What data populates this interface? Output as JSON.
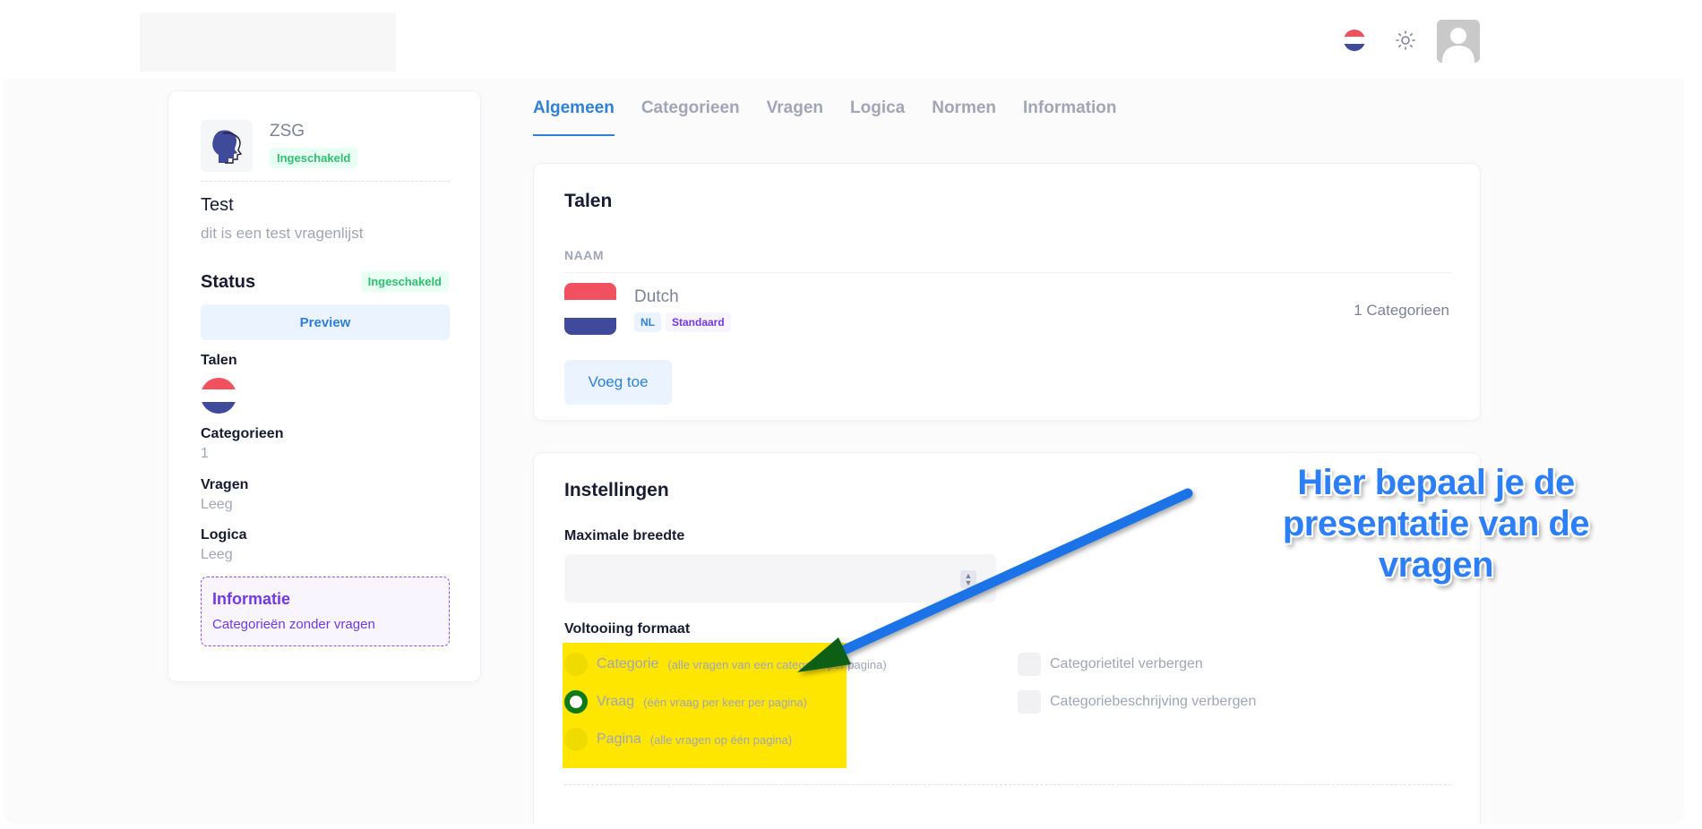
{
  "header": {
    "language_flag": "flag-nl-icon",
    "theme_icon": "sun-icon",
    "avatar_icon": "user-avatar-icon"
  },
  "sidebar": {
    "org_name": "ZSG",
    "org_status": "Ingeschakeld",
    "title": "Test",
    "description": "dit is een test vragenlijst",
    "status_label": "Status",
    "status_badge": "Ingeschakeld",
    "preview_button": "Preview",
    "talen_label": "Talen",
    "categorieen_label": "Categorieen",
    "categorieen_value": "1",
    "vragen_label": "Vragen",
    "vragen_value": "Leeg",
    "logica_label": "Logica",
    "logica_value": "Leeg",
    "info_title": "Informatie",
    "info_text": "Categorieën zonder vragen"
  },
  "tabs": [
    "Algemeen",
    "Categorieen",
    "Vragen",
    "Logica",
    "Normen",
    "Information"
  ],
  "active_tab": "Algemeen",
  "talen_card": {
    "title": "Talen",
    "column_header": "NAAM",
    "languages": [
      {
        "name": "Dutch",
        "code": "NL",
        "default_badge": "Standaard",
        "count": "1 Categorieen"
      }
    ],
    "add_button": "Voeg toe"
  },
  "settings_card": {
    "title": "Instellingen",
    "max_width_label": "Maximale breedte",
    "max_width_value": "",
    "format_label": "Voltooiing formaat",
    "format_options": [
      {
        "label": "Categorie",
        "hint": "(alle vragen van een categorie per pagina)",
        "checked": false
      },
      {
        "label": "Vraag",
        "hint": "(één vraag per keer per pagina)",
        "checked": true
      },
      {
        "label": "Pagina",
        "hint": "(alle vragen op één pagina)",
        "checked": false
      }
    ],
    "checkboxes": [
      {
        "label": "Categorietitel verbergen",
        "checked": false
      },
      {
        "label": "Categoriebeschrijving verbergen",
        "checked": false
      }
    ]
  },
  "annotation": {
    "line1": "Hier bepaal je de",
    "line2": "presentatie van de vragen",
    "arrow_color": "#1a73e8",
    "highlight_color": "#ffe600"
  },
  "colors": {
    "primary": "#2f80d8",
    "success": "#2fbf71",
    "purple": "#7239ea"
  }
}
